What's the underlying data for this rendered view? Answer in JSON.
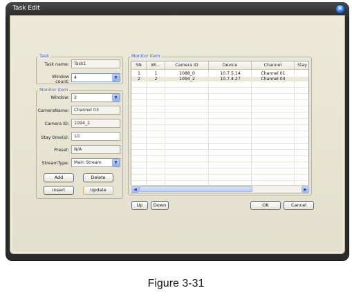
{
  "window": {
    "title": "Task Edit",
    "close_icon": "close-icon"
  },
  "task": {
    "group_label": "Task",
    "name_label": "Task name:",
    "name_value": "Task1",
    "window_count_label": "Window count:",
    "window_count_value": "4"
  },
  "monitor_item": {
    "group_label": "Monitor item",
    "window_label": "Window:",
    "window_value": "2",
    "camera_name_label": "CameraName:",
    "camera_name_value": "Channel 03",
    "camera_id_label": "Camera ID:",
    "camera_id_value": "1094_2",
    "stay_time_label": "Stay time(s):",
    "stay_time_value": "10",
    "preset_label": "Preset:",
    "preset_value": "N/A",
    "stream_type_label": "StreamType:",
    "stream_type_value": "Main Stream",
    "buttons": {
      "add": "Add",
      "delete": "Delete",
      "insert": "Insert",
      "update": "Update"
    }
  },
  "monitor_list": {
    "group_label": "Monitor item",
    "columns": [
      "SN",
      "Wi...",
      "Camera ID",
      "Device",
      "Channel",
      "Stay"
    ],
    "rows": [
      [
        "1",
        "1",
        "1088_0",
        "10.7.5.14",
        "Channel 01",
        ""
      ],
      [
        "2",
        "2",
        "1094_2",
        "10.7.4.27",
        "Channel 03",
        ""
      ]
    ],
    "selected_row": 2
  },
  "footer_buttons": {
    "up": "Up",
    "down": "Down",
    "ok": "OK",
    "cancel": "Cancel"
  },
  "caption": "Figure 3-31",
  "colors": {
    "accent": "#4a63c5",
    "selection": "#ece9d8",
    "frame": "#2b2b2b"
  }
}
